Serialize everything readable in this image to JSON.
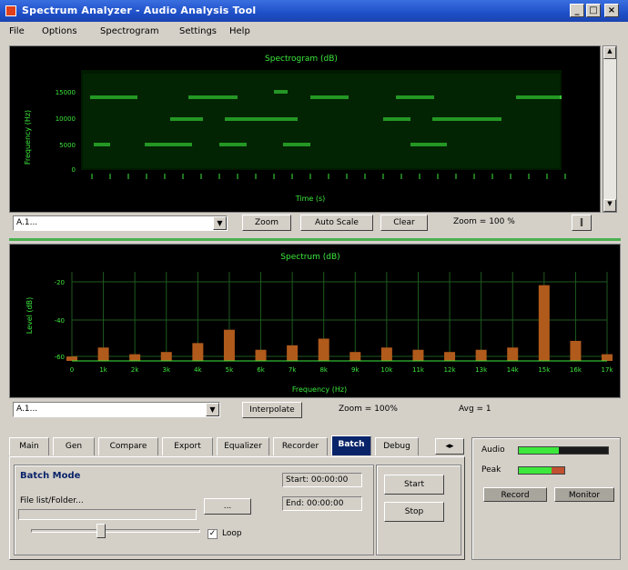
{
  "window": {
    "title": "Spectrum Analyzer - Audio Analysis Tool",
    "minimize_glyph": "_",
    "maximize_glyph": "□",
    "close_glyph": "×"
  },
  "menu": [
    "File",
    "Options",
    "Spectrogram",
    "Settings",
    "Help"
  ],
  "spectrogram": {
    "title": "Spectrogram (dB)",
    "ylabel": "Frequency (Hz)",
    "xlabel": "Time (s)",
    "ytick_labels": [
      "15000",
      "10000",
      "5000",
      "0"
    ],
    "background": "#001000",
    "trace_color": "#3ce83c"
  },
  "spectro_toolbar": {
    "combo_value": "A.1...",
    "zoom_button": "Zoom",
    "autoscale_button": "Auto Scale",
    "clear_button": "Clear",
    "status_text": "Zoom = 100 %",
    "scroll_glyph": "‖"
  },
  "spectrum": {
    "title": "Spectrum (dB)",
    "ylabel": "Level (dB)",
    "xlabel": "Frequency (Hz)",
    "ytick_labels": [
      "-20",
      "-40",
      "-60"
    ],
    "xtick_labels": [
      "0",
      "1k",
      "2k",
      "3k",
      "4k",
      "5k",
      "6k",
      "7k",
      "8k",
      "9k",
      "10k",
      "11k",
      "12k",
      "13k",
      "14k",
      "15k",
      "16k",
      "17k"
    ],
    "bar_color": "#b05a1c",
    "grid_color": "#1f5a1f"
  },
  "chart_data": {
    "type": "area",
    "title": "Spectrum (dB)",
    "xlabel": "Frequency (Hz)",
    "ylabel": "Level (dB)",
    "x": [
      0,
      1,
      2,
      3,
      4,
      5,
      6,
      7,
      8,
      9,
      10,
      11,
      12,
      13,
      14,
      15,
      16,
      17
    ],
    "values": [
      2,
      6,
      3,
      4,
      8,
      14,
      5,
      7,
      10,
      4,
      6,
      5,
      4,
      5,
      6,
      34,
      9,
      3
    ],
    "grid": true
  },
  "spectrum_toolbar": {
    "combo_value": "A.1...",
    "interpolate_button": "Interpolate",
    "zoom_status": "Zoom = 100%",
    "avg_status": "Avg = 1"
  },
  "tabs": [
    "Main",
    "Gen",
    "Compare",
    "Export",
    "Equalizer",
    "Recorder",
    "Batch",
    "Debug"
  ],
  "active_tab_index": 6,
  "batch_tab": {
    "group_title": "Batch Mode",
    "file_label": "File list/Folder...",
    "browse_button": "...",
    "start_time_label": "Start: 00:00:00",
    "end_time_label": "End: 00:00:00",
    "loop_label": "Loop",
    "loop_checked": true,
    "start_button": "Start",
    "stop_button": "Stop"
  },
  "right_panel": {
    "input_label": "Audio",
    "input_level": 0.45,
    "peak_label": "Peak",
    "peak_level": 0.72,
    "button_one": "Record",
    "button_two": "Monitor"
  }
}
